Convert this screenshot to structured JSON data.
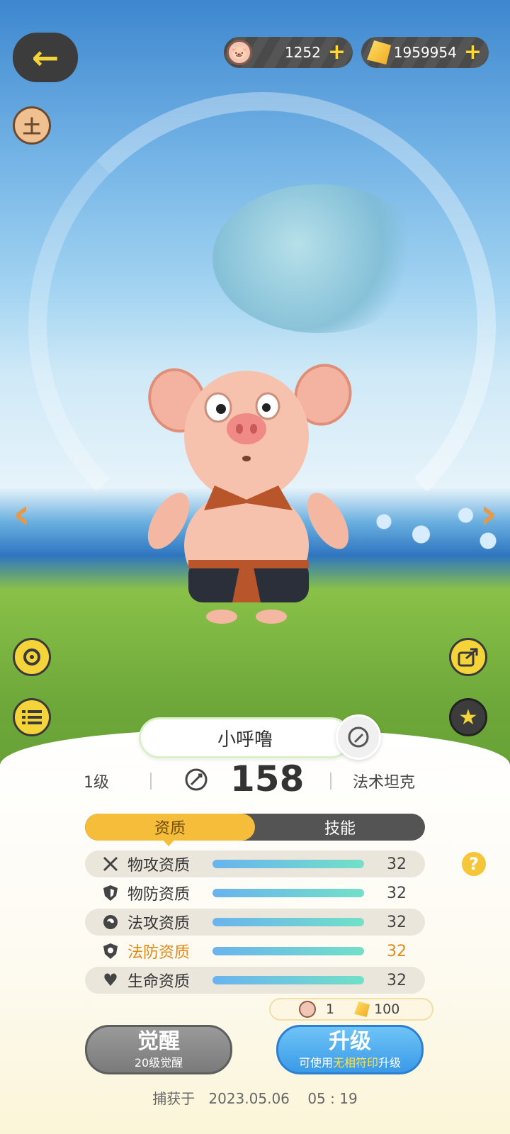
{
  "currency": {
    "pig_coin": "1252",
    "gems": "1959954",
    "plus": "+"
  },
  "side_arrows": {
    "left": "‹",
    "right": "›"
  },
  "pet": {
    "name": "小呼噜",
    "level": "1级",
    "power": "158",
    "role": "法术坦克"
  },
  "tabs": [
    {
      "label": "资质",
      "active": true
    },
    {
      "label": "技能",
      "active": false
    }
  ],
  "stats": [
    {
      "label": "物攻资质",
      "value": "32",
      "fill": 1.0,
      "icon": "crossed-swords-icon",
      "highlight": false
    },
    {
      "label": "物防资质",
      "value": "32",
      "fill": 1.0,
      "icon": "shield-icon",
      "highlight": false
    },
    {
      "label": "法攻资质",
      "value": "32",
      "fill": 1.0,
      "icon": "magic-orb-icon",
      "highlight": false
    },
    {
      "label": "法防资质",
      "value": "32",
      "fill": 1.0,
      "icon": "magic-shield-icon",
      "highlight": true
    },
    {
      "label": "生命资质",
      "value": "32",
      "fill": 1.0,
      "icon": "heart-icon",
      "highlight": false
    }
  ],
  "help": "?",
  "cost": {
    "pig_coin": "1",
    "gems": "100"
  },
  "buttons": {
    "awaken_label": "觉醒",
    "awaken_sub": "20级觉醒",
    "upgrade_label": "升级",
    "upgrade_sub_a": "可使用",
    "upgrade_sub_b": "无相符印",
    "upgrade_sub_c": "升级"
  },
  "caught": {
    "label": "捕获于",
    "date": "2023.05.06",
    "time": "05 : 19"
  },
  "colors": {
    "accent_yellow": "#f5bd3a",
    "upgrade_blue": "#3a9ae8",
    "highlight_orange": "#e08a1a"
  }
}
